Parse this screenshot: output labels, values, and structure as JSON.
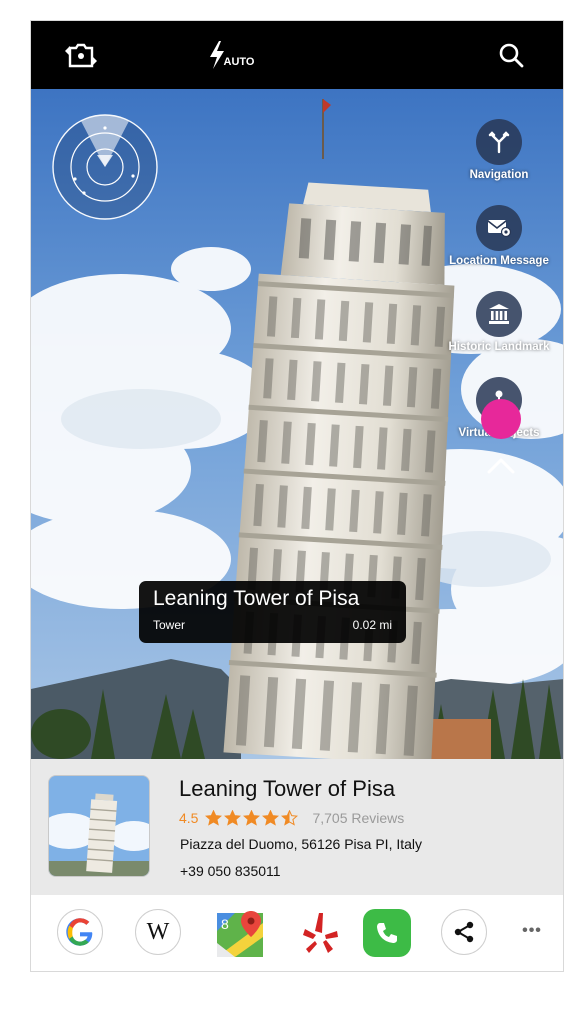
{
  "top_bar": {
    "flash_mode": "AUTO",
    "icons": [
      "switch-camera-icon",
      "flash-icon",
      "search-icon"
    ]
  },
  "side_actions": [
    {
      "label": "Navigation",
      "icon": "navigation-icon"
    },
    {
      "label": "Location Message",
      "icon": "location-message-icon"
    },
    {
      "label": "Historic Landmark",
      "icon": "landmark-icon"
    },
    {
      "label": "Virtual Objects",
      "icon": "virtual-objects-icon"
    }
  ],
  "poi_label": {
    "title": "Leaning Tower of Pisa",
    "type": "Tower",
    "distance": "0.02 mi"
  },
  "info_card": {
    "title": "Leaning Tower of Pisa",
    "rating_value": "4.5",
    "rating_stars": 4.5,
    "reviews": "7,705 Reviews",
    "address": "Piazza del Duomo, 56126 Pisa PI, Italy",
    "phone": "+39 050 835011"
  },
  "apps": [
    "google-icon",
    "wikipedia-icon",
    "google-maps-icon",
    "yelp-icon",
    "phone-icon",
    "share-icon"
  ],
  "more_label": "•••",
  "colors": {
    "top_bar": "#000000",
    "accent_rating": "#f08a24",
    "touch_indicator": "#e7289a",
    "action_circle": "#283755"
  }
}
